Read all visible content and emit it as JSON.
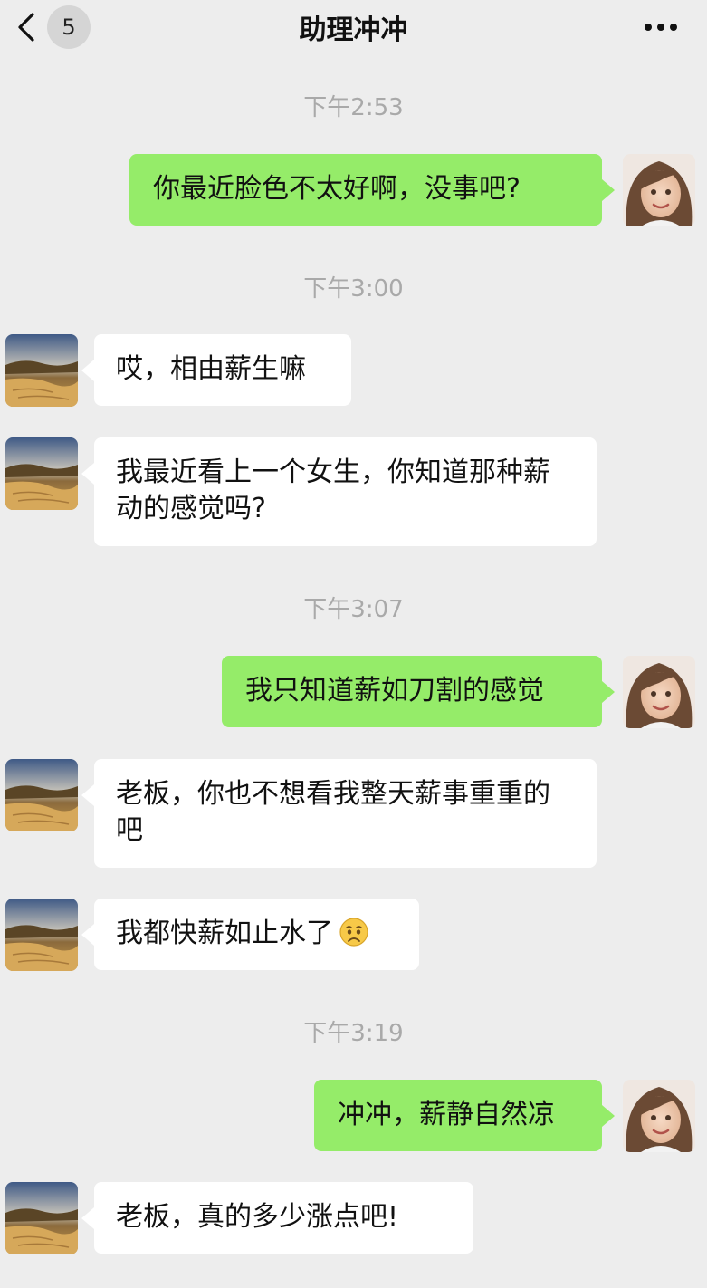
{
  "header": {
    "unread_count": "5",
    "title": "助理冲冲"
  },
  "icons": {
    "back": "chevron-left-icon",
    "more": "more-dots-icon",
    "avatar_self": "girl-portrait-avatar",
    "avatar_other": "desert-landscape-avatar",
    "emoji": "sad-face-emoji"
  },
  "colors": {
    "background": "#ededed",
    "outgoing_bubble": "#95ec69",
    "incoming_bubble": "#ffffff",
    "timestamp": "#a9a9a9"
  },
  "timestamps": [
    "下午2:53",
    "下午3:00",
    "下午3:07",
    "下午3:19"
  ],
  "messages": [
    {
      "from": "me",
      "text": "你最近脸色不太好啊，没事吧?"
    },
    {
      "from": "other",
      "text": "哎，相由薪生嘛"
    },
    {
      "from": "other",
      "text": "我最近看上一个女生，你知道那种薪动的感觉吗?"
    },
    {
      "from": "me",
      "text": "我只知道薪如刀割的感觉"
    },
    {
      "from": "other",
      "text": "老板，你也不想看我整天薪事重重的吧"
    },
    {
      "from": "other",
      "text": "我都快薪如止水了"
    },
    {
      "from": "me",
      "text": "冲冲，薪静自然凉"
    },
    {
      "from": "other",
      "text": "老板，真的多少涨点吧!"
    }
  ]
}
